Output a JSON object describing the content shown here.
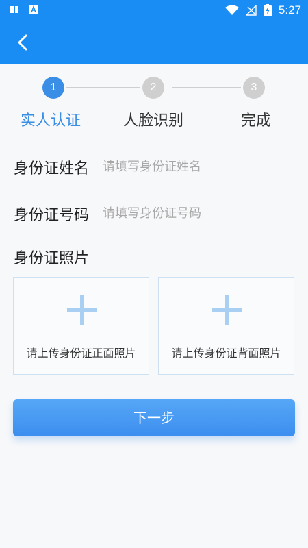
{
  "status_bar": {
    "time": "5:27",
    "icons": [
      "notification-book-icon",
      "notification-a-icon",
      "wifi-icon",
      "signal-off-icon",
      "battery-charging-icon"
    ]
  },
  "app_bar": {
    "back_icon": "chevron-left-icon",
    "color": "#1a8df4"
  },
  "steps": [
    {
      "number": "1",
      "label": "实人认证",
      "active": true
    },
    {
      "number": "2",
      "label": "人脸识别",
      "active": false
    },
    {
      "number": "3",
      "label": "完成",
      "active": false
    }
  ],
  "form": {
    "name_label": "身份证姓名",
    "name_placeholder": "请填写身份证姓名",
    "id_label": "身份证号码",
    "id_placeholder": "请填写身份证号码",
    "photo_label": "身份证照片",
    "upload_front": "请上传身份证正面照片",
    "upload_back": "请上传身份证背面照片"
  },
  "actions": {
    "next_label": "下一步"
  },
  "colors": {
    "accent": "#3a8ee6",
    "inactive": "#cfcfcf"
  }
}
